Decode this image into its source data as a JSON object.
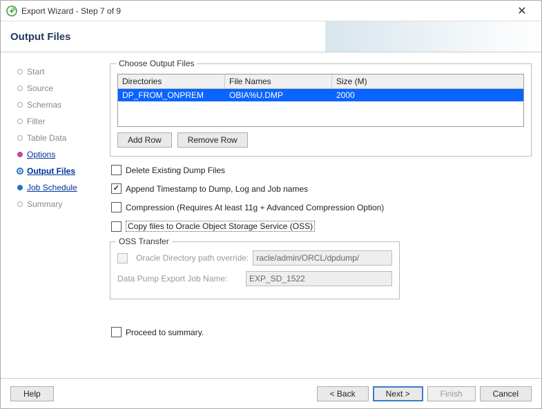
{
  "window": {
    "title": "Export Wizard - Step 7 of 9"
  },
  "header": {
    "title": "Output Files"
  },
  "nav": {
    "items": [
      {
        "label": "Start",
        "state": "done"
      },
      {
        "label": "Source",
        "state": "done"
      },
      {
        "label": "Schemas",
        "state": "done"
      },
      {
        "label": "Filter",
        "state": "done"
      },
      {
        "label": "Table Data",
        "state": "done"
      },
      {
        "label": "Options",
        "state": "link"
      },
      {
        "label": "Output Files",
        "state": "active"
      },
      {
        "label": "Job Schedule",
        "state": "link"
      },
      {
        "label": "Summary",
        "state": "future"
      }
    ]
  },
  "choose": {
    "legend": "Choose Output Files",
    "columns": {
      "dir": "Directories",
      "file": "File Names",
      "size": "Size (M)"
    },
    "row": {
      "dir": "DP_FROM_ONPREM",
      "file": "OBIA%U.DMP",
      "size": "2000"
    },
    "add": "Add Row",
    "remove": "Remove Row"
  },
  "checks": {
    "delete": "Delete Existing Dump Files",
    "append": "Append Timestamp to Dump, Log and Job names",
    "compress": "Compression (Requires At least 11g + Advanced Compression Option)",
    "copy": "Copy files to Oracle Object Storage Service (OSS)",
    "proceed": "Proceed to summary."
  },
  "oss": {
    "legend": "OSS Transfer",
    "override_label": "Oracle Directory path override:",
    "override_value": "racle/admin/ORCL/dpdump/",
    "job_label": "Data Pump Export Job Name:",
    "job_value": "EXP_SD_1522"
  },
  "footer": {
    "help": "Help",
    "back": "< Back",
    "next": "Next >",
    "finish": "Finish",
    "cancel": "Cancel"
  }
}
